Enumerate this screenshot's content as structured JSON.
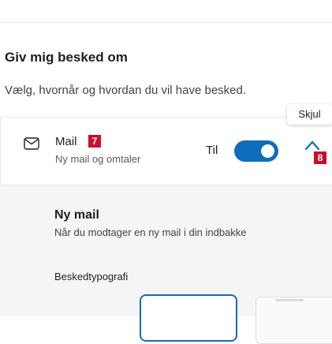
{
  "section": {
    "title": "Giv mig besked om",
    "description": "Vælg, hvornår og hvordan du vil have besked."
  },
  "tooltip": {
    "text": "Skjul"
  },
  "mail_channel": {
    "icon": "mail-icon",
    "title": "Mail",
    "subtitle": "Ny mail og omtaler",
    "toggle_label": "Til",
    "toggle_on": true,
    "collapse_icon": "chevron-up-icon"
  },
  "badges": {
    "mail": "7",
    "collapse": "8"
  },
  "new_mail": {
    "title": "Ny mail",
    "description": "Når du modtager en ny mail i din indbakke",
    "typography_label": "Beskedtypografi"
  },
  "colors": {
    "accent": "#0f6cbd",
    "badge": "#c8102e",
    "panel_background": "#f5f5f5"
  }
}
